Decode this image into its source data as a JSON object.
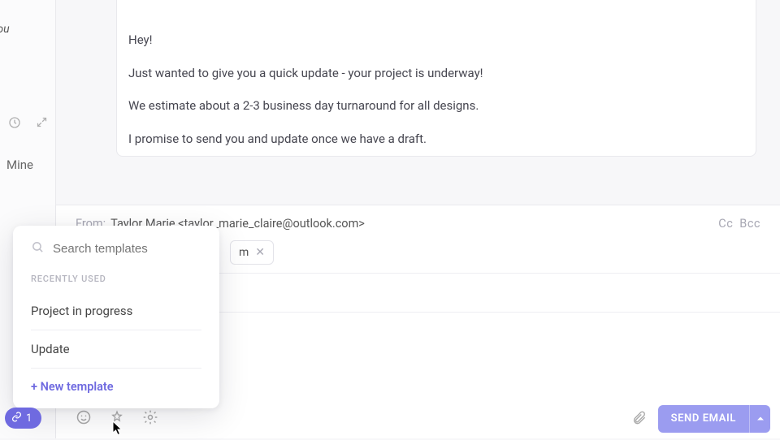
{
  "sidebar": {
    "you_label": "you",
    "mine_label": "Mine"
  },
  "message": {
    "line1": "Hey!",
    "line2": "Just wanted to give you a quick update - your project is underway!",
    "line3": "We estimate about a 2-3 business day turnaround for all designs.",
    "line4": "I promise to send you and update once we have a draft."
  },
  "compose": {
    "from_label": "From:",
    "from_value": "Taylor Marie <taylor_marie_claire@outlook.com>",
    "cc_label": "Cc",
    "bcc_label": "Bcc",
    "recipient_chip_suffix": "m",
    "send_label": "SEND EMAIL"
  },
  "templates_popover": {
    "search_placeholder": "Search templates",
    "section_label": "RECENTLY USED",
    "items": [
      {
        "label": "Project in progress"
      },
      {
        "label": "Update"
      }
    ],
    "new_label": "+ New template"
  },
  "link_pill": {
    "count": "1"
  }
}
